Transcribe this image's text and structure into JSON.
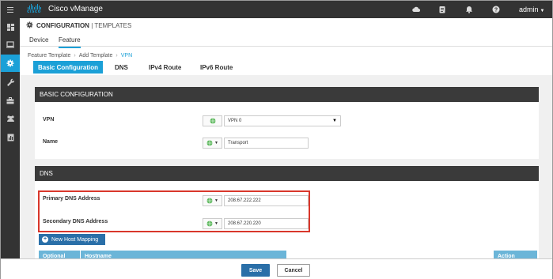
{
  "app": {
    "brand_word": "cisco",
    "title": "Cisco vManage",
    "user": "admin",
    "accent_color": "#1ba0d7",
    "topbar_icons": [
      "cloud-icon",
      "clipboard-icon",
      "bell-icon",
      "help-icon"
    ]
  },
  "sidebar": {
    "items": [
      {
        "icon": "dashboard-icon"
      },
      {
        "icon": "monitor-icon"
      },
      {
        "icon": "gear-icon",
        "active": true
      },
      {
        "icon": "wrench-icon"
      },
      {
        "icon": "toolbox-icon"
      },
      {
        "icon": "users-icon"
      },
      {
        "icon": "analytics-icon"
      }
    ]
  },
  "header": {
    "title": "CONFIGURATION",
    "subtitle": "| TEMPLATES"
  },
  "tabs": [
    {
      "label": "Device"
    },
    {
      "label": "Feature",
      "active": true
    }
  ],
  "breadcrumb": {
    "items": [
      "Feature Template",
      "Add Template"
    ],
    "current": "VPN"
  },
  "subtabs": [
    {
      "label": "Basic Configuration",
      "active": true
    },
    {
      "label": "DNS"
    },
    {
      "label": "IPv4 Route"
    },
    {
      "label": "IPv6 Route"
    }
  ],
  "basic": {
    "heading": "BASIC CONFIGURATION",
    "vpn_label": "VPN",
    "vpn_value": "VPN 0",
    "name_label": "Name",
    "name_value": "Transport"
  },
  "dns": {
    "heading": "DNS",
    "primary_label": "Primary DNS Address",
    "primary_value": "208.67.222.222",
    "secondary_label": "Secondary DNS Address",
    "secondary_value": "208.67.220.220",
    "add_button": "New Host Mapping",
    "columns": [
      "Optional",
      "Hostname"
    ],
    "action_column": "Action"
  },
  "footer": {
    "save": "Save",
    "cancel": "Cancel"
  }
}
